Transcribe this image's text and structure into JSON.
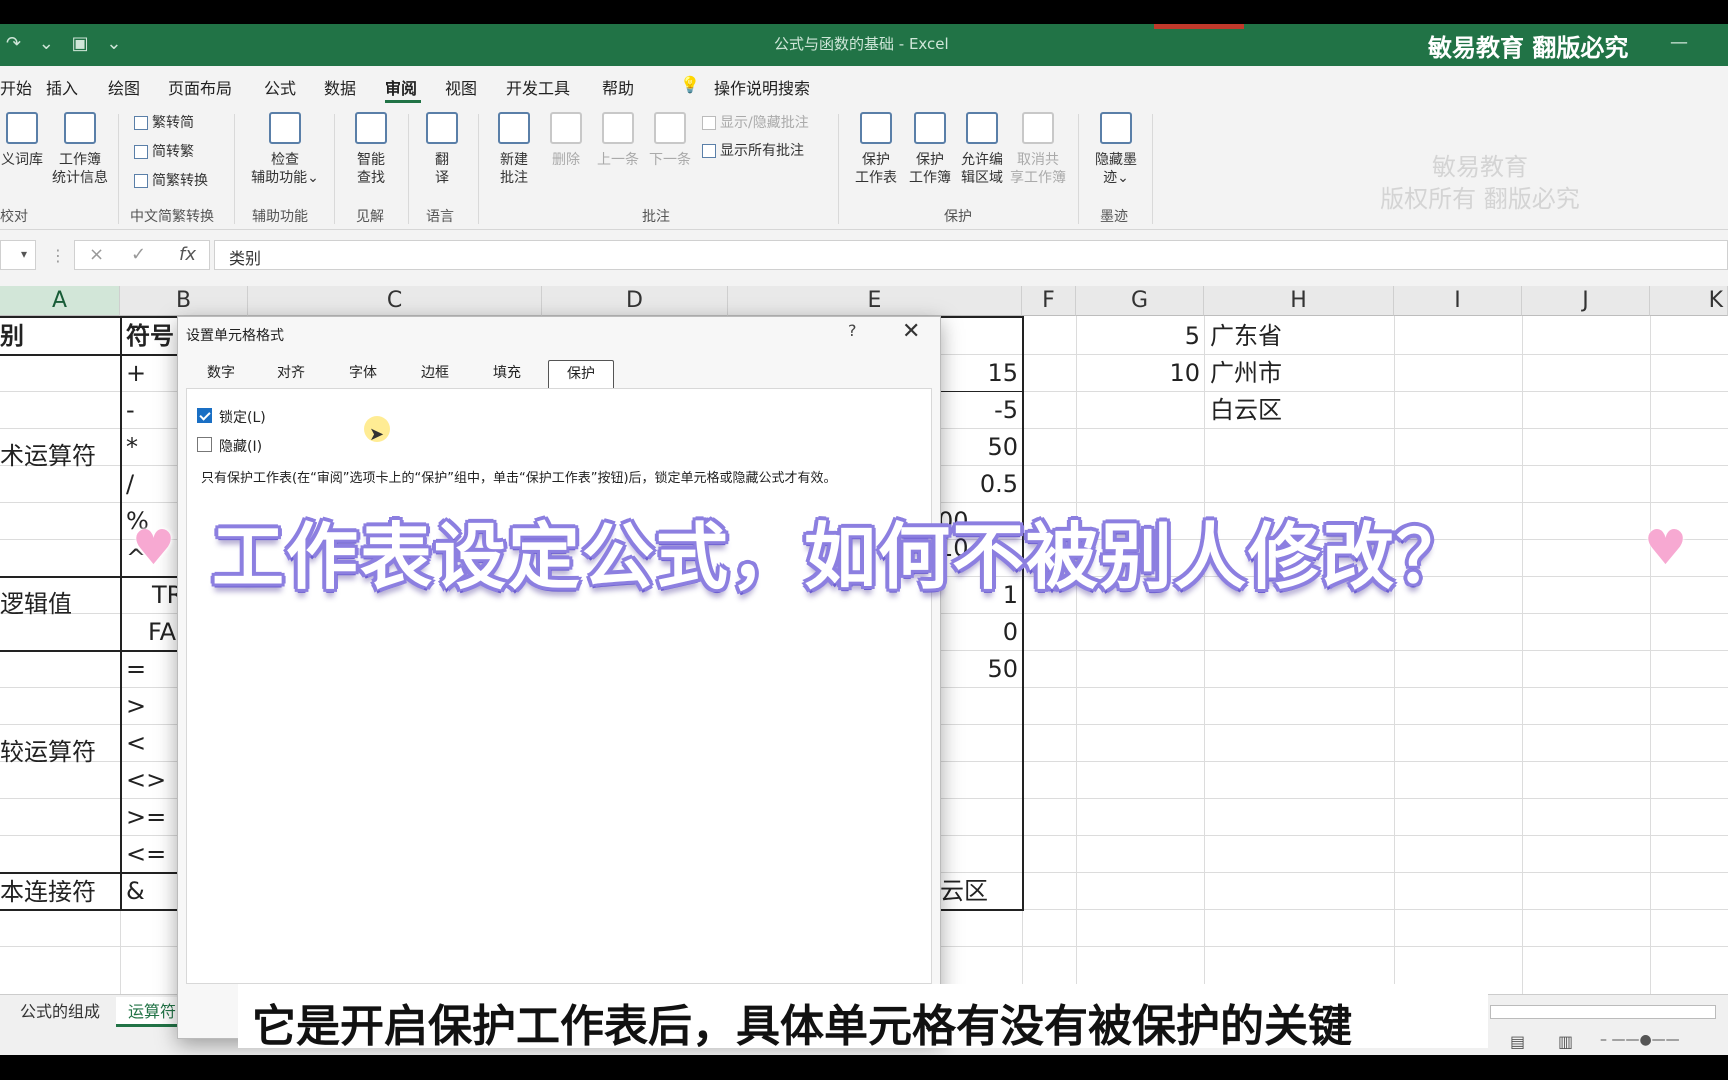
{
  "window": {
    "title": "公式与函数的基础 - Excel",
    "watermark": "敏易教育 翻版必究",
    "ribbon_watermark_line1": "敏易教育",
    "ribbon_watermark_line2": "版权所有 翻版必究"
  },
  "menu": {
    "items": [
      "开始",
      "插入",
      "绘图",
      "页面布局",
      "公式",
      "数据",
      "审阅",
      "视图",
      "开发工具",
      "帮助"
    ],
    "search": "操作说明搜索",
    "active": "审阅"
  },
  "ribbon": {
    "proofing": {
      "btn1": "义词库",
      "btn2a": "工作簿",
      "btn2b": "统计信息",
      "group": "校对"
    },
    "chinese": {
      "a": "繁转简",
      "b": "简转繁",
      "c": "简繁转换",
      "group": "中文简繁转换"
    },
    "accessibility": {
      "a": "检查",
      "b": "辅助功能",
      "group": "辅助功能"
    },
    "insights": {
      "a": "智能",
      "b": "查找",
      "group": "见解"
    },
    "language": {
      "a": "翻",
      "b": "译",
      "group": "语言"
    },
    "comments": {
      "new_a": "新建",
      "new_b": "批注",
      "delete": "删除",
      "prev": "上一条",
      "next": "下一条",
      "show_hide": "显示/隐藏批注",
      "show_all": "显示所有批注",
      "group": "批注"
    },
    "protect": {
      "sheet_a": "保护",
      "sheet_b": "工作表",
      "book_a": "保护",
      "book_b": "工作簿",
      "allow_a": "允许编",
      "allow_b": "辑区域",
      "unshare_a": "取消共",
      "unshare_b": "享工作簿",
      "group": "保护"
    },
    "ink": {
      "a": "隐藏墨",
      "b": "迹",
      "group": "墨迹"
    }
  },
  "formula_bar": {
    "value": "类别",
    "fx": "fx",
    "cancel": "×",
    "enter": "✓"
  },
  "columns": [
    "A",
    "B",
    "C",
    "D",
    "E",
    "F",
    "G",
    "H",
    "I",
    "J",
    "K"
  ],
  "cells": {
    "a1": "别",
    "b1": "符号",
    "b_arith": [
      "+",
      "-",
      "*",
      "/",
      "%",
      "^"
    ],
    "a_arith": "术运算符",
    "a_logic": "逻辑值",
    "b_logic": [
      "TR",
      "FA"
    ],
    "a_compare": "较运算符",
    "b_compare": [
      "=",
      ">",
      "<",
      "<>",
      ">=",
      "<="
    ],
    "a_concat": "本连接符",
    "b_concat": "&",
    "e_values": [
      "15",
      "-5",
      "50",
      "0.5",
      "00",
      "10",
      "1",
      "0",
      "50"
    ],
    "e_concat": "云区",
    "g_values": [
      "5",
      "10"
    ],
    "h_values": [
      "广东省",
      "广州市",
      "白云区"
    ]
  },
  "sheet_tabs": [
    "公式的组成",
    "运算符"
  ],
  "dialog": {
    "title": "设置单元格格式",
    "help": "?",
    "close": "✕",
    "tabs": [
      "数字",
      "对齐",
      "字体",
      "边框",
      "填充",
      "保护"
    ],
    "active_tab": "保护",
    "locked_label": "锁定(L)",
    "locked_checked": true,
    "hidden_label": "隐藏(I)",
    "hidden_checked": false,
    "note": "只有保护工作表(在“审阅”选项卡上的“保护”组中，单击“保护工作表”按钮)后，锁定单元格或隐藏公式才有效。"
  },
  "overlay": {
    "banner": "工作表设定公式，如何不被别人修改？",
    "heart": "♥",
    "subtitle": "它是开启保护工作表后，具体单元格有没有被保护的关键"
  },
  "colors": {
    "excel_green": "#217346",
    "banner_stroke": "#8c7fe0",
    "heart": "#f7a9d2"
  }
}
